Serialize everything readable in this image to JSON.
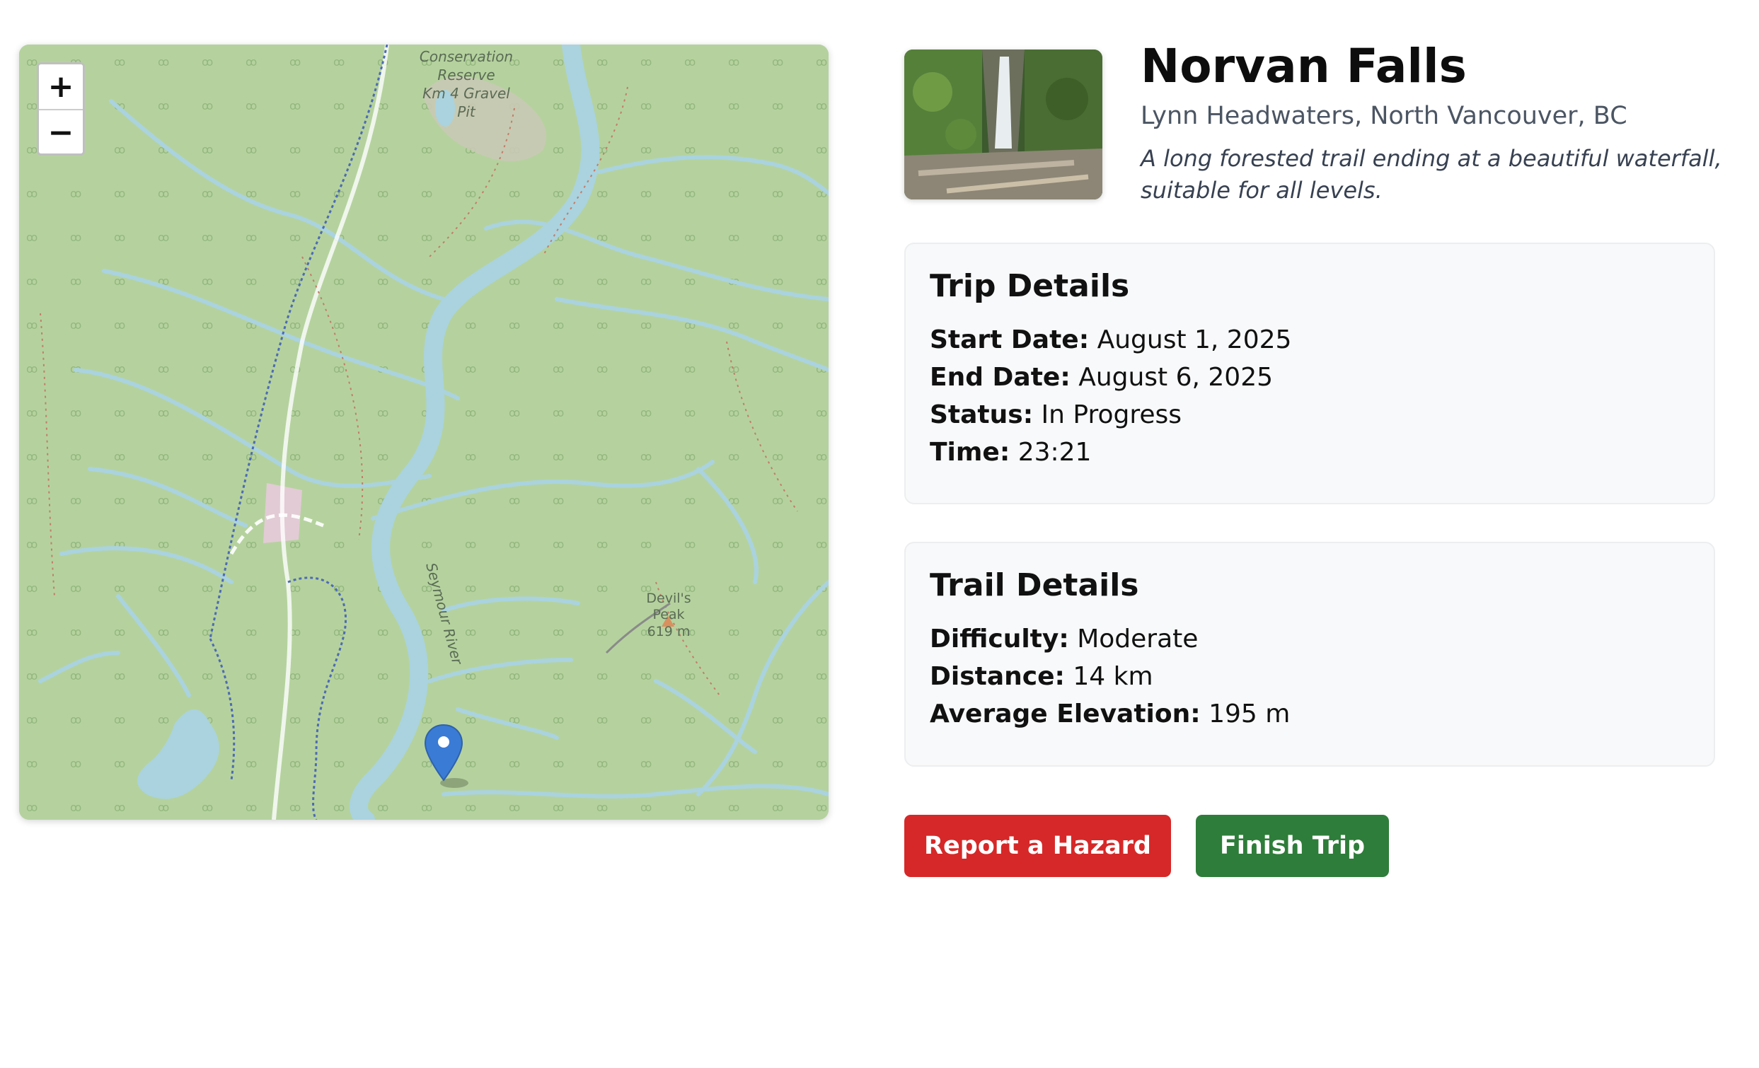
{
  "map": {
    "zoom_in_label": "+",
    "zoom_out_label": "−",
    "labels": {
      "reserve_line1": "Conservation",
      "reserve_line2": "Reserve",
      "reserve_line3": "Km 4 Gravel",
      "reserve_line4": "Pit",
      "river": "Seymour River",
      "peak_name_line1": "Devil's",
      "peak_name_line2": "Peak",
      "peak_elevation": "619 m"
    },
    "colors": {
      "land": "#b5d29e",
      "water": "#aad3df",
      "marker": "#3a7bd5"
    }
  },
  "trail": {
    "name": "Norvan Falls",
    "location": "Lynn Headwaters, North Vancouver, BC",
    "description": "A long forested trail ending at a beautiful waterfall, suitable for all levels."
  },
  "trip_details": {
    "heading": "Trip Details",
    "rows": [
      {
        "key": "Start Date:",
        "value": "August 1, 2025"
      },
      {
        "key": "End Date:",
        "value": "August 6, 2025"
      },
      {
        "key": "Status:",
        "value": "In Progress"
      },
      {
        "key": "Time:",
        "value": "23:21"
      }
    ]
  },
  "trail_details": {
    "heading": "Trail Details",
    "rows": [
      {
        "key": "Difficulty:",
        "value": "Moderate"
      },
      {
        "key": "Distance:",
        "value": "14 km"
      },
      {
        "key": "Average Elevation:",
        "value": "195 m"
      }
    ]
  },
  "actions": {
    "report_hazard": "Report a Hazard",
    "finish_trip": "Finish Trip",
    "colors": {
      "hazard": "#d62828",
      "finish": "#2e7d3a"
    }
  }
}
